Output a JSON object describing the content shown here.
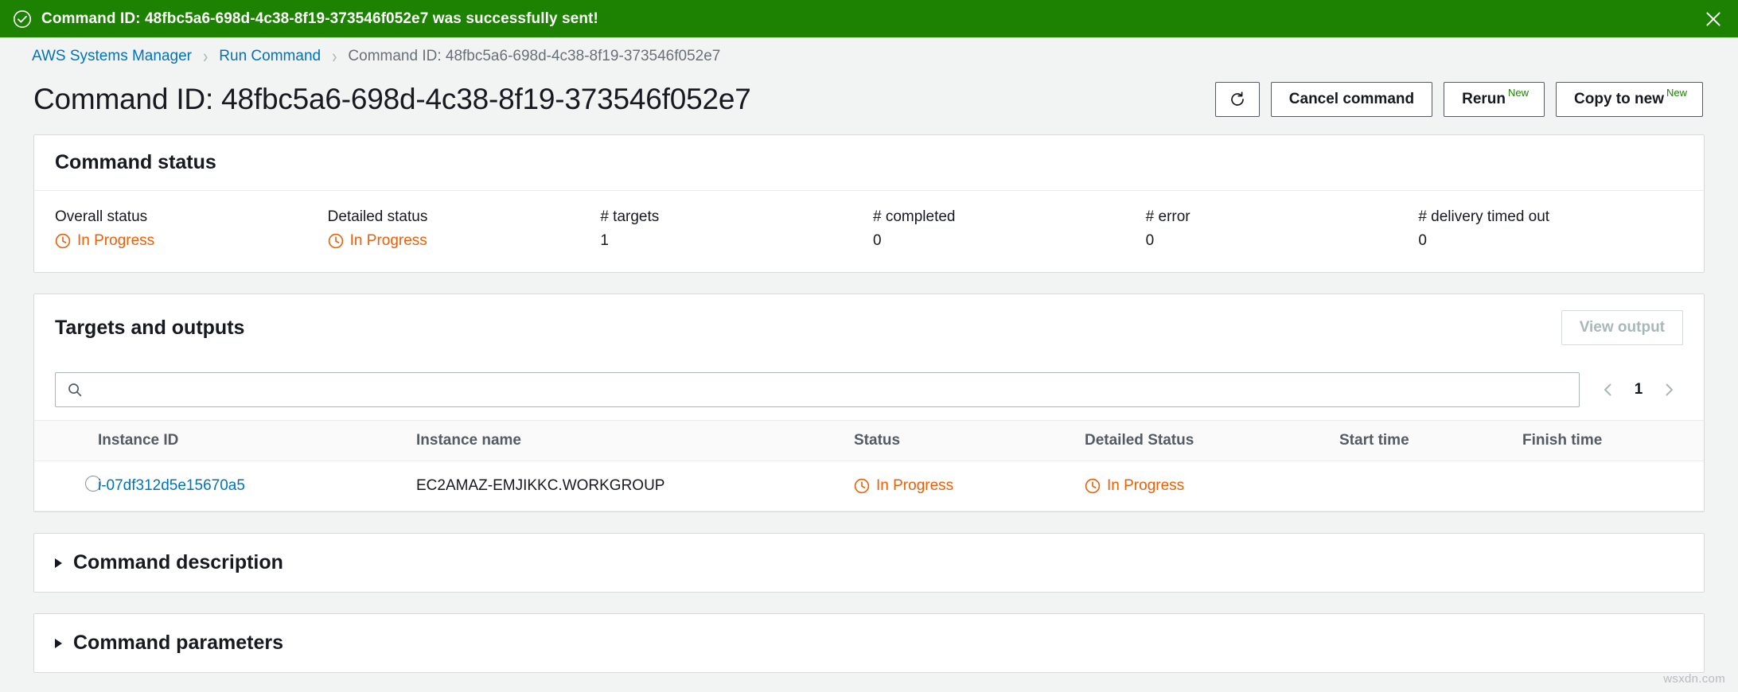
{
  "flash": {
    "message": "Command ID: 48fbc5a6-698d-4c38-8f19-373546f052e7 was successfully sent!",
    "icon": "check-circle-icon",
    "close_icon": "close-icon",
    "background_color": "#1d8102",
    "text_color": "#ffffff"
  },
  "breadcrumb": {
    "items": [
      {
        "label": "AWS Systems Manager",
        "type": "link"
      },
      {
        "label": "Run Command",
        "type": "link"
      },
      {
        "label": "Command ID: 48fbc5a6-698d-4c38-8f19-373546f052e7",
        "type": "current"
      }
    ],
    "separator": "›",
    "link_color": "#0073bb",
    "current_color": "#687078"
  },
  "header": {
    "title": "Command ID: 48fbc5a6-698d-4c38-8f19-373546f052e7",
    "actions": {
      "refresh": {
        "label": "",
        "icon": "refresh-icon"
      },
      "cancel": {
        "label": "Cancel command"
      },
      "rerun": {
        "label": "Rerun",
        "badge": "New"
      },
      "copy_to_new": {
        "label": "Copy to new",
        "badge": "New"
      }
    },
    "badge_color": "#1d8102"
  },
  "command_status": {
    "title": "Command status",
    "fields": [
      {
        "label": "Overall status",
        "value": "In Progress",
        "state": "in-progress",
        "icon": "clock-icon"
      },
      {
        "label": "Detailed status",
        "value": "In Progress",
        "state": "in-progress",
        "icon": "clock-icon"
      },
      {
        "label": "# targets",
        "value": "1",
        "state": "plain"
      },
      {
        "label": "# completed",
        "value": "0",
        "state": "plain"
      },
      {
        "label": "# error",
        "value": "0",
        "state": "plain"
      },
      {
        "label": "# delivery timed out",
        "value": "0",
        "state": "plain"
      }
    ],
    "in_progress_color": "#eb5f07"
  },
  "targets_and_outputs": {
    "title": "Targets and outputs",
    "view_output_button": {
      "label": "View output",
      "disabled": true
    },
    "search": {
      "value": "",
      "placeholder": "",
      "icon": "search-icon"
    },
    "pagination": {
      "prev_icon": "chevron-left-icon",
      "next_icon": "chevron-right-icon",
      "current_page": "1"
    },
    "columns": [
      "Instance ID",
      "Instance name",
      "Status",
      "Detailed Status",
      "Start time",
      "Finish time"
    ],
    "rows": [
      {
        "selected": false,
        "instance_id": "i-07df312d5e15670a5",
        "instance_name": "EC2AMAZ-EMJIKKC.WORKGROUP",
        "status": "In Progress",
        "detailed_status": "In Progress",
        "start_time": "",
        "finish_time": ""
      }
    ]
  },
  "sections": [
    {
      "title": "Command description",
      "expanded": false,
      "icon": "caret-right-icon"
    },
    {
      "title": "Command parameters",
      "expanded": false,
      "icon": "caret-right-icon"
    }
  ],
  "watermark": {
    "text": "wsxdn.com"
  }
}
